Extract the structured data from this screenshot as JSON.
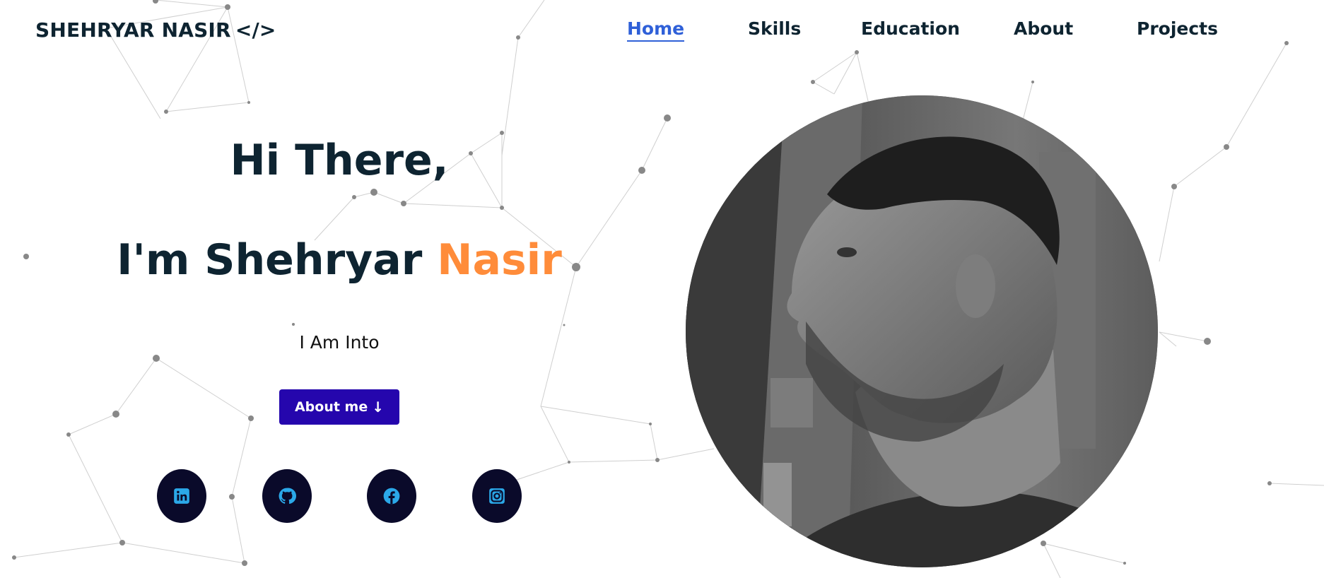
{
  "header": {
    "logo_text": "SHEHRYAR NASIR",
    "logo_code": "</>",
    "nav": [
      {
        "label": "Home",
        "active": true
      },
      {
        "label": "Skills",
        "active": false
      },
      {
        "label": "Education",
        "active": false
      },
      {
        "label": "About",
        "active": false
      },
      {
        "label": "Projects",
        "active": false
      }
    ]
  },
  "hero": {
    "greeting": "Hi There,",
    "name_prefix": "I'm Shehryar ",
    "name_accent": "Nasir",
    "subtitle": "I Am Into",
    "button_label": "About me",
    "button_icon": "arrow-down-icon"
  },
  "social": [
    {
      "name": "linkedin-icon"
    },
    {
      "name": "github-icon"
    },
    {
      "name": "facebook-icon"
    },
    {
      "name": "instagram-icon"
    }
  ],
  "colors": {
    "text_dark": "#0e2431",
    "nav_active": "#2f60d8",
    "accent": "#ff8c3a",
    "button_bg": "#2506ad",
    "social_bg": "#0a0a2a",
    "social_icon": "#2ba8e8"
  },
  "photo": {
    "subject": "profile-photo"
  }
}
